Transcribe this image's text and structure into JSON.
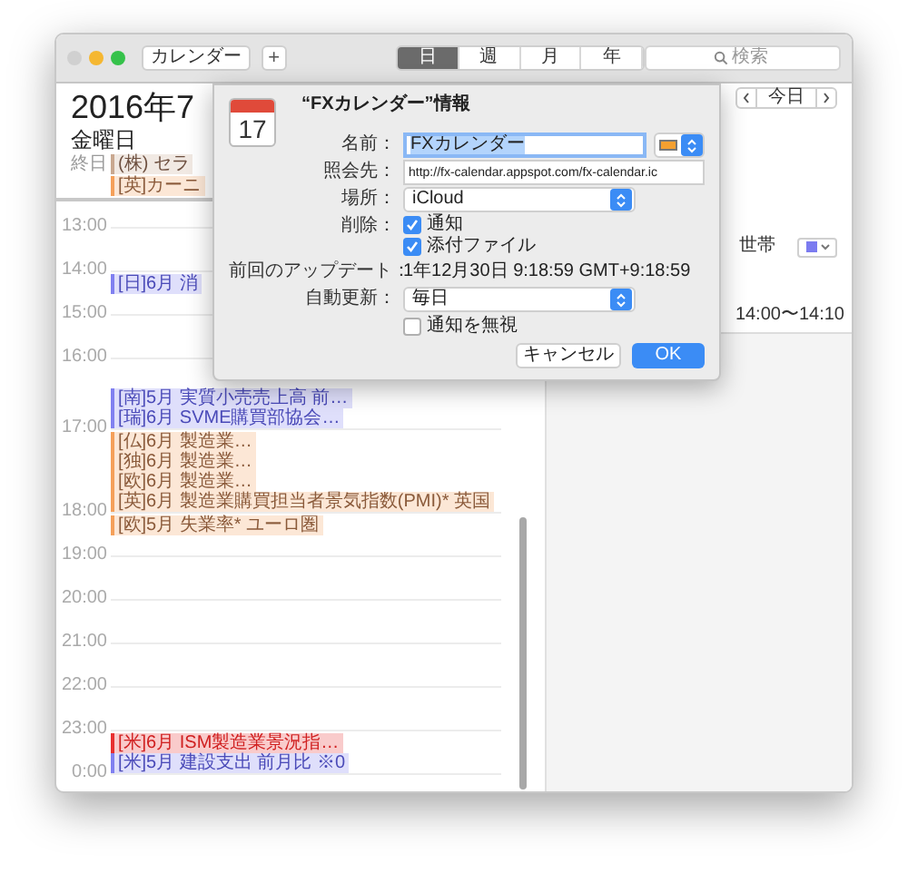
{
  "toolbar": {
    "calendars_button": "カレンダー",
    "add_button": "+",
    "view_tabs": [
      {
        "label": "日",
        "selected": true
      },
      {
        "label": "週",
        "selected": false
      },
      {
        "label": "月",
        "selected": false
      },
      {
        "label": "年",
        "selected": false
      }
    ],
    "search": {
      "placeholder": "検索"
    }
  },
  "day_view": {
    "title": "2016年7",
    "weekday": "金曜日",
    "all_day_label": "終日",
    "all_day_events": [
      {
        "title": "(株) セラ",
        "color": "#c9a890"
      },
      {
        "title": "[英]カーニ",
        "color": "#f5a05a"
      }
    ],
    "hours": [
      {
        "time": "13:00"
      },
      {
        "time": "14:00",
        "events": [
          {
            "title": "[日]6月 消",
            "color": "#8080f0"
          }
        ]
      },
      {
        "time": "15:00"
      },
      {
        "time": "16:00",
        "events": [
          {
            "title": "[南]5月 実質小売売上高 前…",
            "color": "#8080f0"
          },
          {
            "title": "[瑞]6月 SVME購買部協会…",
            "color": "#8080f0"
          }
        ]
      },
      {
        "time": "17:00",
        "events": [
          {
            "title": "[仏]6月 製造業…",
            "color": "#f5a05a"
          },
          {
            "title": "[独]6月 製造業…",
            "color": "#f5a05a"
          },
          {
            "title": "[欧]6月 製造業…",
            "color": "#f5a05a"
          },
          {
            "title": "[英]6月 製造業購買担当者景気指数(PMI)* 英国",
            "color": "#f5a05a"
          }
        ]
      },
      {
        "time": "18:00",
        "events": [
          {
            "title": "[欧]5月 失業率* ユーロ圏",
            "color": "#f5a05a"
          }
        ]
      },
      {
        "time": "19:00"
      },
      {
        "time": "20:00"
      },
      {
        "time": "21:00"
      },
      {
        "time": "22:00"
      },
      {
        "time": "23:00",
        "events": [
          {
            "title": "[米]6月 ISM製造業景況指…",
            "color": "#e83030"
          },
          {
            "title": "[米]5月 建設支出 前月比 ※0",
            "color": "#8080f0"
          }
        ]
      },
      {
        "time": "0:00"
      }
    ]
  },
  "event_detail": {
    "today_button": "今日",
    "title": "世帯",
    "time": "14:00〜14:10"
  },
  "dialog": {
    "icon_date": "17",
    "title": "“FXカレンダー”情報",
    "name": {
      "label": "名前：",
      "value": "FXカレンダー",
      "text_selected": true
    },
    "url": {
      "label": "照会先：",
      "value": "http://fx-calendar.appspot.com/fx-calendar.ic"
    },
    "location": {
      "label": "場所：",
      "value": "iCloud"
    },
    "remove": {
      "label": "削除：",
      "options": [
        {
          "label": "通知",
          "checked": true
        },
        {
          "label": "添付ファイル",
          "checked": true
        }
      ]
    },
    "last_update": {
      "label": "前回のアップデート：",
      "value": "1年12月30日 9:18:59 GMT+9:18:59"
    },
    "auto_refresh": {
      "label": "自動更新：",
      "value": "毎日"
    },
    "ignore_alerts": {
      "label": "通知を無視",
      "checked": false
    },
    "buttons": [
      {
        "label": "キャンセル",
        "kind": "secondary"
      },
      {
        "label": "OK",
        "kind": "primary"
      }
    ]
  }
}
